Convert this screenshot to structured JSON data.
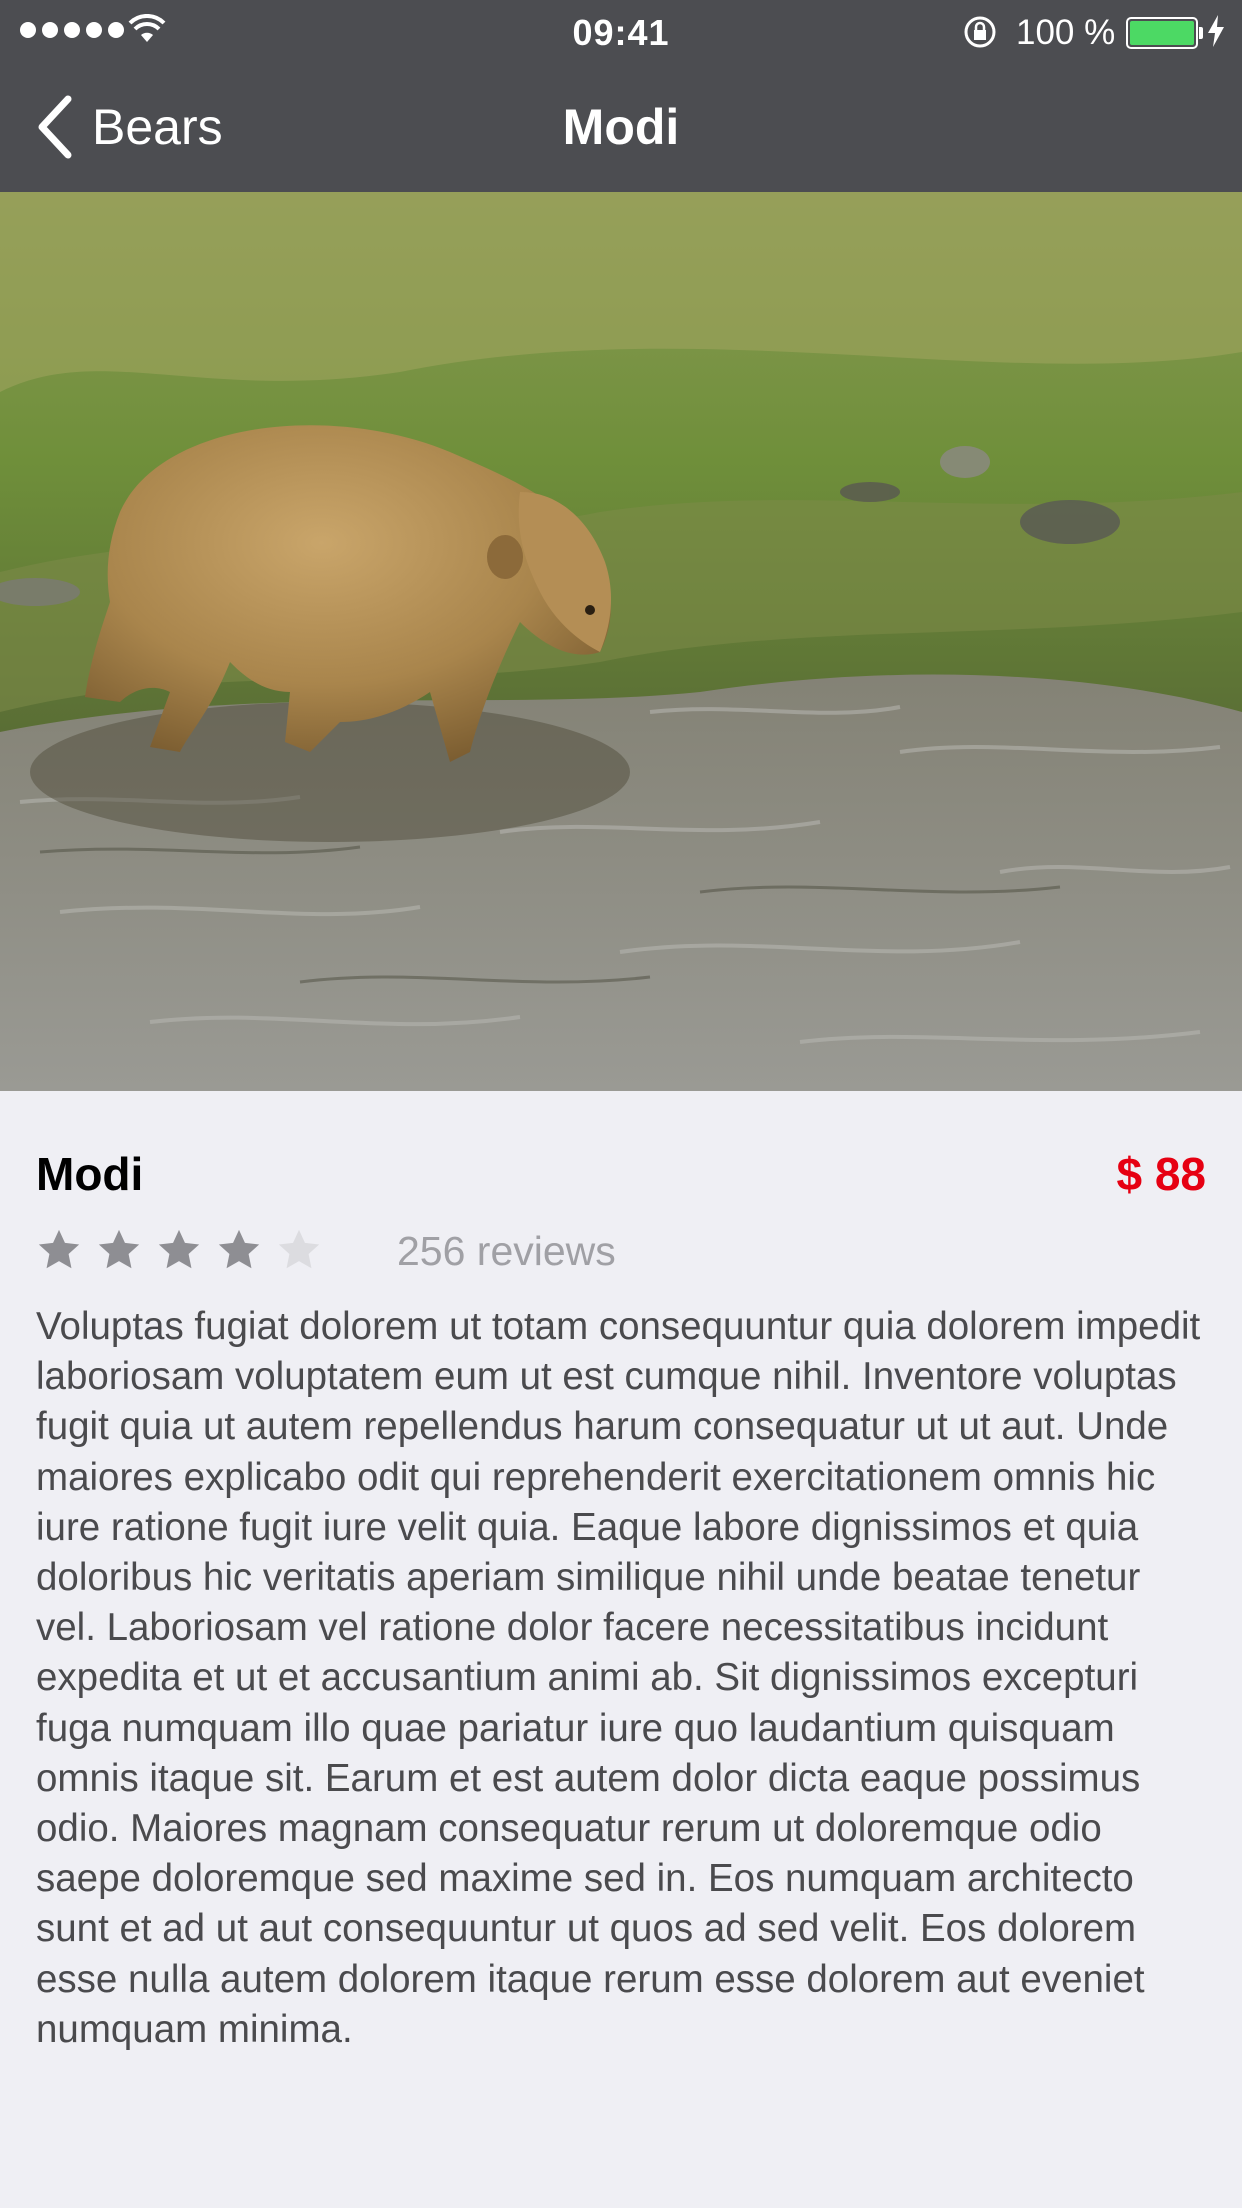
{
  "status_bar": {
    "time": "09:41",
    "battery_percent": "100 %",
    "battery_color": "#4cd964",
    "signal_icon": "signal-dots-icon",
    "wifi_icon": "wifi-icon",
    "lock_icon": "rotation-lock-icon",
    "charging_icon": "charging-bolt-icon"
  },
  "nav": {
    "back_label": "Bears",
    "title": "Modi"
  },
  "item": {
    "name": "Modi",
    "price": "$ 88",
    "price_color": "#e60012",
    "rating": 4,
    "rating_max": 5,
    "reviews": "256 reviews",
    "description": "Voluptas fugiat dolorem ut totam consequuntur quia dolorem impedit laboriosam voluptatem eum ut est cumque nihil. Inventore voluptas fugit quia ut autem repellendus harum consequatur ut ut aut. Unde maiores explicabo odit qui reprehenderit exercitationem omnis hic iure ratione fugit iure velit quia. Eaque labore dignissimos et quia doloribus hic veritatis aperiam similique nihil unde beatae tenetur vel. Laboriosam vel ratione dolor facere necessitatibus incidunt expedita et ut et accusantium animi ab. Sit dignissimos excepturi fuga numquam illo quae pariatur iure quo laudantium quisquam omnis itaque sit. Earum et est autem dolor dicta eaque possimus odio. Maiores magnam consequatur rerum ut doloremque odio saepe doloremque sed maxime sed in. Eos numquam architecto sunt et ad ut aut consequuntur ut quos ad sed velit. Eos dolorem esse nulla autem dolorem itaque rerum esse dolorem aut eveniet numquam minima."
  }
}
